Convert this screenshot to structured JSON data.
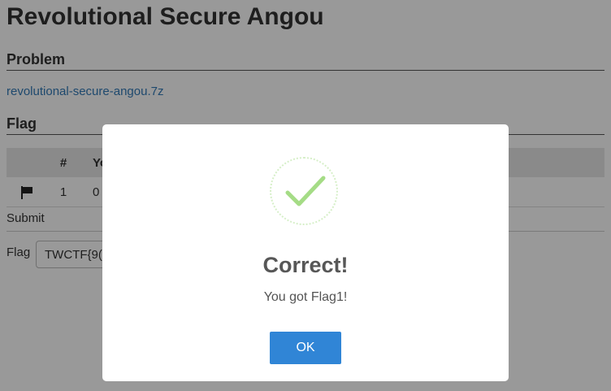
{
  "page": {
    "title": "Revolutional Secure Angou"
  },
  "problem": {
    "heading": "Problem",
    "file_link": "revolutional-secure-angou.7z"
  },
  "flag_section": {
    "heading": "Flag",
    "table": {
      "headers": [
        "",
        "#",
        "Yo"
      ],
      "rows": [
        {
          "icon": "flag-icon",
          "number": "1",
          "value": "0"
        }
      ]
    },
    "submit_label": "Submit",
    "field_label": "Flag",
    "input_value": "TWCTF{9("
  },
  "modal": {
    "icon": "checkmark-icon",
    "title": "Correct!",
    "text": "You got Flag1!",
    "ok_label": "OK"
  },
  "colors": {
    "accent_button": "#3085d6",
    "success_check": "#a5dc86",
    "link": "#337ab7"
  }
}
